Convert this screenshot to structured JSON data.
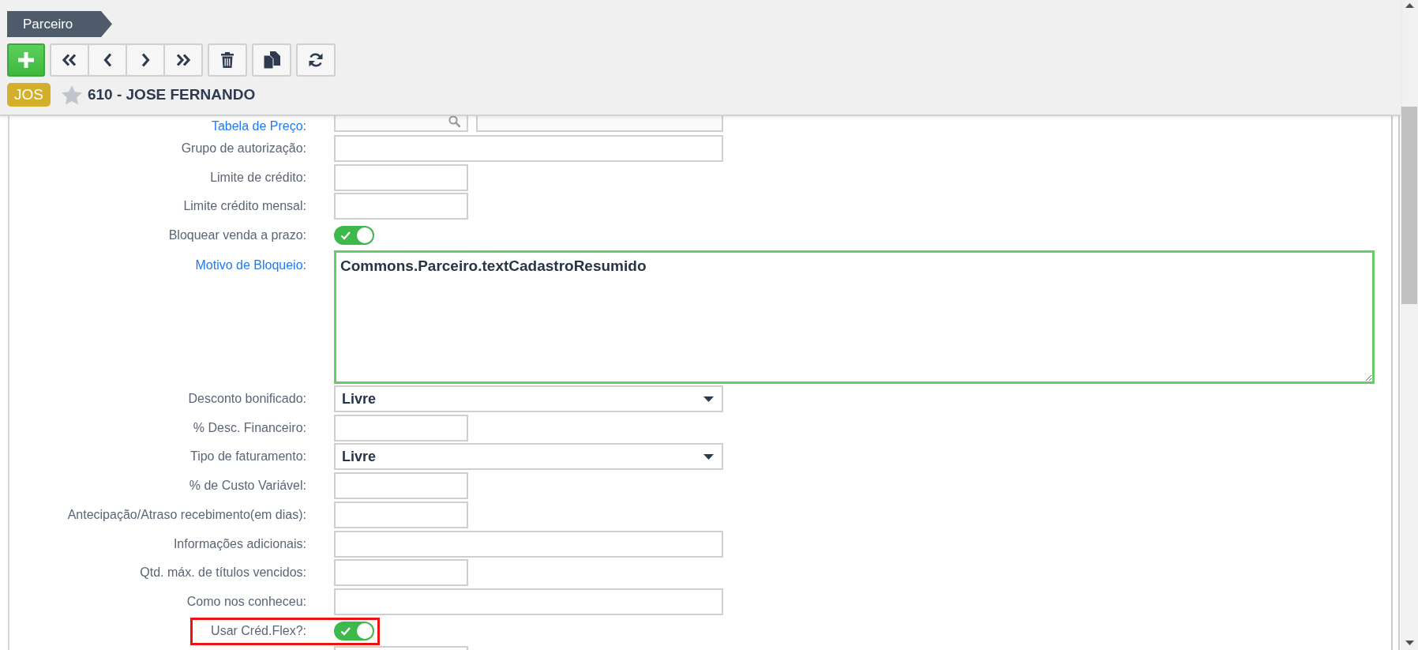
{
  "breadcrumb": {
    "label": "Parceiro"
  },
  "record": {
    "badge": "JOS",
    "favorite": false,
    "title": "610 - JOSE FERNANDO"
  },
  "form": {
    "fields": [
      {
        "label": "Tabela de Preço:",
        "link": true,
        "kind": "lookup",
        "highlighted": false
      },
      {
        "label": "Grupo de autorização:",
        "link": false,
        "kind": "text",
        "highlighted": false
      },
      {
        "label": "Limite de crédito:",
        "link": false,
        "kind": "number",
        "highlighted": false
      },
      {
        "label": "Limite crédito mensal:",
        "link": false,
        "kind": "number",
        "highlighted": false
      },
      {
        "label": "Bloquear venda a prazo:",
        "link": false,
        "kind": "toggle",
        "on": true,
        "highlighted": false
      },
      {
        "label": "Motivo de Bloqueio:",
        "link": true,
        "kind": "textarea",
        "value": "Commons.Parceiro.textCadastroResumido",
        "focused": true,
        "highlighted": false
      },
      {
        "label": "Desconto bonificado:",
        "link": false,
        "kind": "select",
        "value": "Livre",
        "highlighted": false
      },
      {
        "label": "% Desc. Financeiro:",
        "link": false,
        "kind": "number",
        "highlighted": false
      },
      {
        "label": "Tipo de faturamento:",
        "link": false,
        "kind": "select",
        "value": "Livre",
        "highlighted": false
      },
      {
        "label": "% de Custo Variável:",
        "link": false,
        "kind": "number",
        "highlighted": false
      },
      {
        "label": "Antecipação/Atraso recebimento(em dias):",
        "link": false,
        "kind": "number",
        "highlighted": false
      },
      {
        "label": "Informações adicionais:",
        "link": false,
        "kind": "text",
        "highlighted": false
      },
      {
        "label": "Qtd. máx. de títulos vencidos:",
        "link": false,
        "kind": "number",
        "highlighted": false
      },
      {
        "label": "Como nos conheceu:",
        "link": false,
        "kind": "text",
        "highlighted": false
      },
      {
        "label": "Usar Créd.Flex?:",
        "link": false,
        "kind": "toggle",
        "on": true,
        "highlighted": true
      },
      {
        "kind": "number",
        "highlighted": false
      }
    ]
  }
}
